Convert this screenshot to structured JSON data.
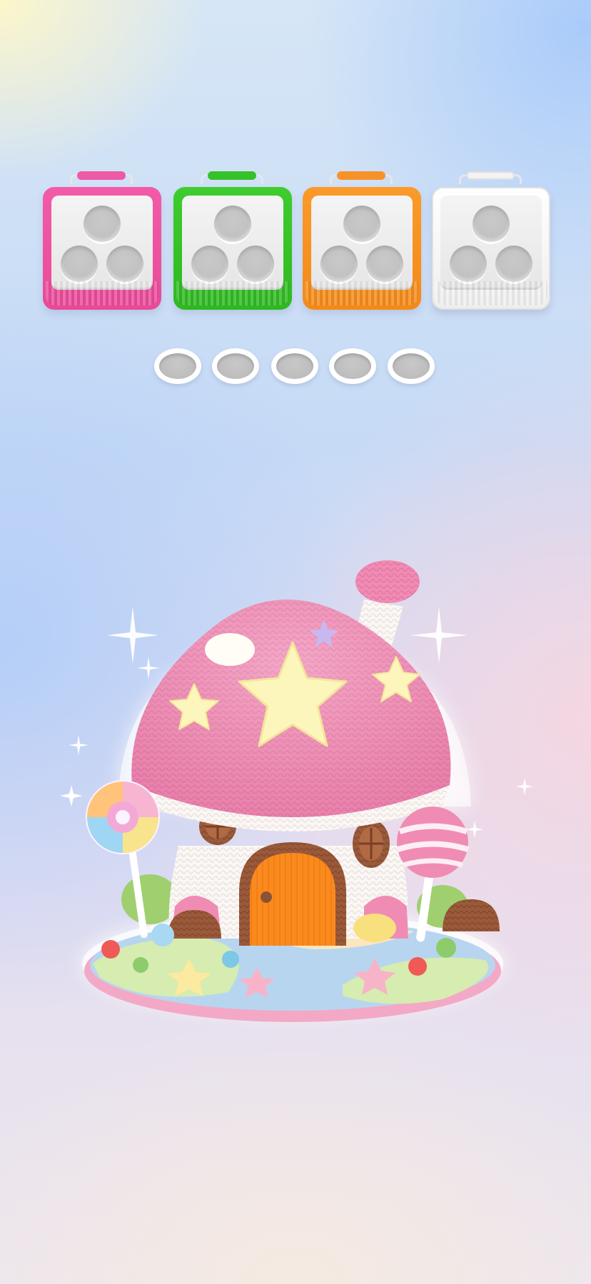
{
  "game": {
    "baskets": [
      {
        "color_name": "pink",
        "color": "#ee5aa4",
        "slots": 3
      },
      {
        "color_name": "green",
        "color": "#35c12a",
        "slots": 3
      },
      {
        "color_name": "orange",
        "color": "#f7922a",
        "slots": 3
      },
      {
        "color_name": "white",
        "color": "#f3f3f3",
        "slots": 3
      }
    ],
    "holding_slots": 5,
    "scene_object": "crochet-mushroom-house",
    "colors": {
      "background_top_left": "#fff7c8",
      "background_blue": "#b2cef8",
      "background_pink": "#f6d6e0",
      "slot_empty": "#c2c2c2"
    }
  }
}
